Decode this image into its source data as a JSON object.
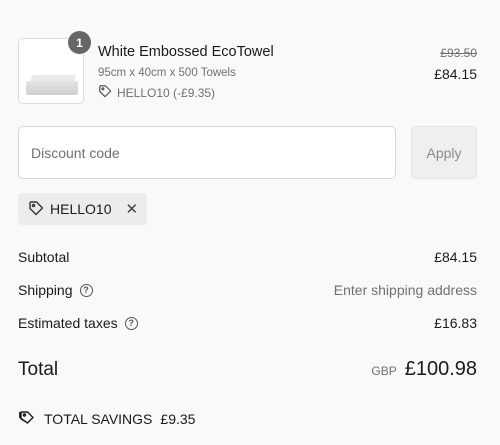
{
  "line_item": {
    "quantity": "1",
    "name": "White Embossed EcoTowel",
    "variant": "95cm x 40cm x 500 Towels",
    "discount_note": "HELLO10 (-£9.35)",
    "original_price": "£93.50",
    "price": "£84.15"
  },
  "discount": {
    "placeholder": "Discount code",
    "apply_label": "Apply",
    "applied_code": "HELLO10"
  },
  "summary": {
    "subtotal_label": "Subtotal",
    "subtotal_value": "£84.15",
    "shipping_label": "Shipping",
    "shipping_value": "Enter shipping address",
    "taxes_label": "Estimated taxes",
    "taxes_value": "£16.83",
    "total_label": "Total",
    "currency": "GBP",
    "total_value": "£100.98",
    "savings_label": "TOTAL SAVINGS",
    "savings_value": "£9.35"
  },
  "icons": {
    "tag": "tag-icon",
    "help": "help-circle-icon",
    "close": "close-icon",
    "savings": "savings-tag-icon"
  },
  "colors": {
    "background": "#f9f9f9",
    "badge": "#666666",
    "muted_text": "#707070",
    "chip_bg": "#ececec"
  }
}
